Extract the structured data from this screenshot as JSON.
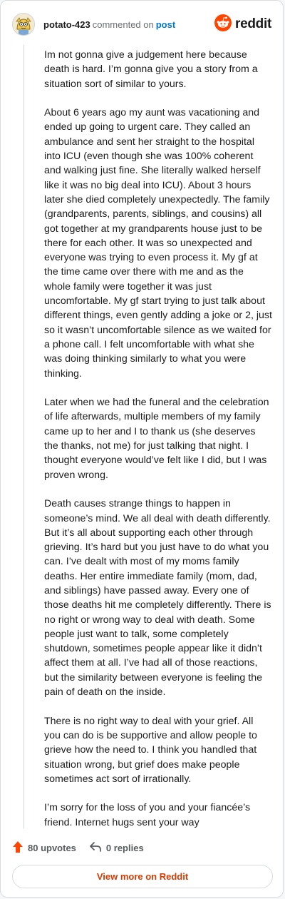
{
  "header": {
    "username": "potato-423",
    "commented_text": "commented on",
    "post_link": "post",
    "brand_name": "reddit"
  },
  "icons": {
    "avatar": "avatar-icon",
    "brand": "reddit-logo-icon",
    "upvote": "upvote-arrow-icon",
    "reply": "reply-icon"
  },
  "colors": {
    "brand": "#ff4500",
    "link": "#0079d3",
    "view_more": "#d93a00"
  },
  "comment": {
    "paragraphs": [
      "Im not gonna give a judgement here because death is hard. I’m gonna give you a story from a situation sort of similar to yours.",
      "About 6 years ago my aunt was vacationing and ended up going to urgent care. They called an ambulance and sent her straight to the hospital into ICU (even though she was 100% coherent and walking just fine. She literally walked herself like it was no big deal into ICU). About 3 hours later she died completely unexpectedly. The family (grandparents, parents, siblings, and cousins) all got together at my grandparents house just to be there for each other. It was so unexpected and everyone was trying to even process it. My gf at the time came over there with me and as the whole family were together it was just uncomfortable. My gf start trying to just talk about different things, even gently adding a joke or 2, just so it wasn’t uncomfortable silence as we waited for a phone call. I felt uncomfortable with what she was doing thinking similarly to what you were thinking.",
      "Later when we had the funeral and the celebration of life afterwards, multiple members of my family came up to her and I to thank us (she deserves the thanks, not me) for just talking that night. I thought everyone would’ve felt like I did, but I was proven wrong.",
      "Death causes strange things to happen in someone’s mind. We all deal with death differently. But it’s all about supporting each other through grieving. It’s hard but you just have to do what you can. I’ve dealt with most of my moms family deaths. Her entire immediate family (mom, dad, and siblings) have passed away. Every one of those deaths hit me completely differently. There is no right or wrong way to deal with death. Some people just want to talk, some completely shutdown, sometimes people appear like it didn’t affect them at all. I’ve had all of those reactions, but the similarity between everyone is feeling the pain of death on the inside.",
      "There is no right way to deal with your grief. All you can do is be supportive and allow people to grieve how the need to. I think you handled that situation wrong, but grief does make people sometimes act sort of irrationally.",
      "I’m sorry for the loss of you and your fiancée’s friend. Internet hugs sent your way"
    ]
  },
  "actions": {
    "upvotes": "80 upvotes",
    "replies": "0 replies"
  },
  "footer": {
    "view_more_label": "View more on Reddit"
  }
}
